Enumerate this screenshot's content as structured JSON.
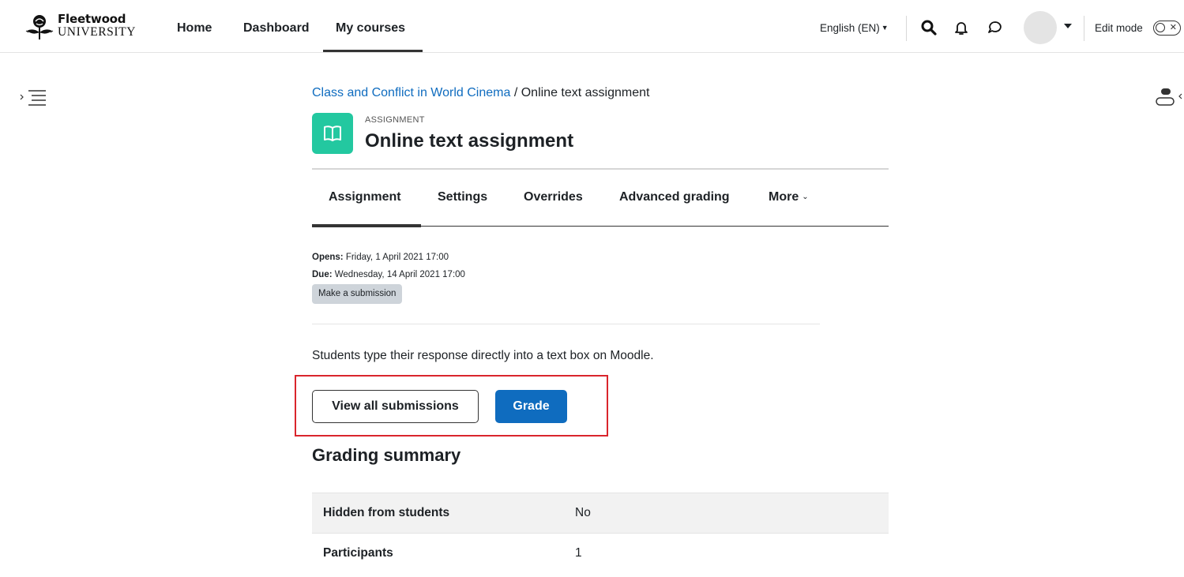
{
  "brand": {
    "name": "Fleetwood",
    "subtitle": "UNIVERSITY"
  },
  "nav": {
    "home": "Home",
    "dashboard": "Dashboard",
    "my_courses": "My courses",
    "language": "English (EN)",
    "edit_mode": "Edit mode"
  },
  "breadcrumb": {
    "course": "Class and Conflict in World Cinema",
    "separator": "/",
    "current": "Online text assignment"
  },
  "activity": {
    "type": "ASSIGNMENT",
    "title": "Online text assignment",
    "icon_color": "#23c8a0"
  },
  "tabs": {
    "assignment": "Assignment",
    "settings": "Settings",
    "overrides": "Overrides",
    "advanced_grading": "Advanced grading",
    "more": "More"
  },
  "dates": {
    "opens_label": "Opens:",
    "opens_value": "Friday, 1 April 2021 17:00",
    "due_label": "Due:",
    "due_value": "Wednesday, 14 April 2021 17:00"
  },
  "make_submission": "Make a submission",
  "intro": "Students type their response directly into a text box on Moodle.",
  "actions": {
    "view_all": "View all submissions",
    "grade": "Grade"
  },
  "grading_summary": {
    "title": "Grading summary",
    "rows": [
      {
        "label": "Hidden from students",
        "value": "No"
      },
      {
        "label": "Participants",
        "value": "1"
      }
    ]
  },
  "colors": {
    "primary": "#0f6cbf",
    "highlight": "#d9252c",
    "link": "#0f6cbf"
  }
}
